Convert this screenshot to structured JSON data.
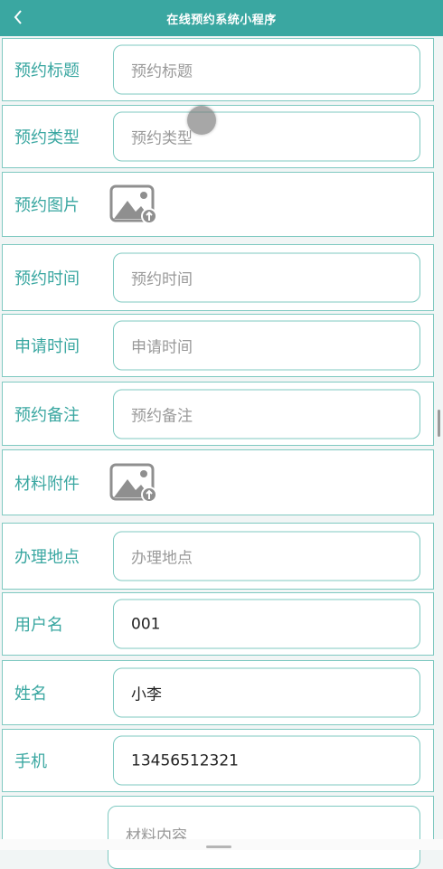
{
  "header": {
    "back_icon": "chevron-left-icon",
    "title": "在线预约系统小程序"
  },
  "form": {
    "fields": [
      {
        "label": "预约标题",
        "placeholder": "预约标题"
      },
      {
        "label": "预约类型",
        "placeholder": "预约类型"
      },
      {
        "label": "预约图片",
        "icon": "image-upload-icon"
      },
      {
        "label": "预约时间",
        "placeholder": "预约时间"
      },
      {
        "label": "申请时间",
        "placeholder": "申请时间"
      },
      {
        "label": "预约备注",
        "placeholder": "预约备注"
      },
      {
        "label": "材料附件",
        "icon": "image-upload-icon"
      },
      {
        "label": "办理地点",
        "placeholder": "办理地点"
      },
      {
        "label": "用户名",
        "value": "001"
      },
      {
        "label": "姓名",
        "value": "小李"
      },
      {
        "label": "手机",
        "value": "13456512321"
      },
      {
        "label": "",
        "placeholder": "材料内容"
      }
    ]
  },
  "colors": {
    "accent": "#3aa7a1",
    "border": "#7fc9c1",
    "background": "#f1f5f5"
  }
}
